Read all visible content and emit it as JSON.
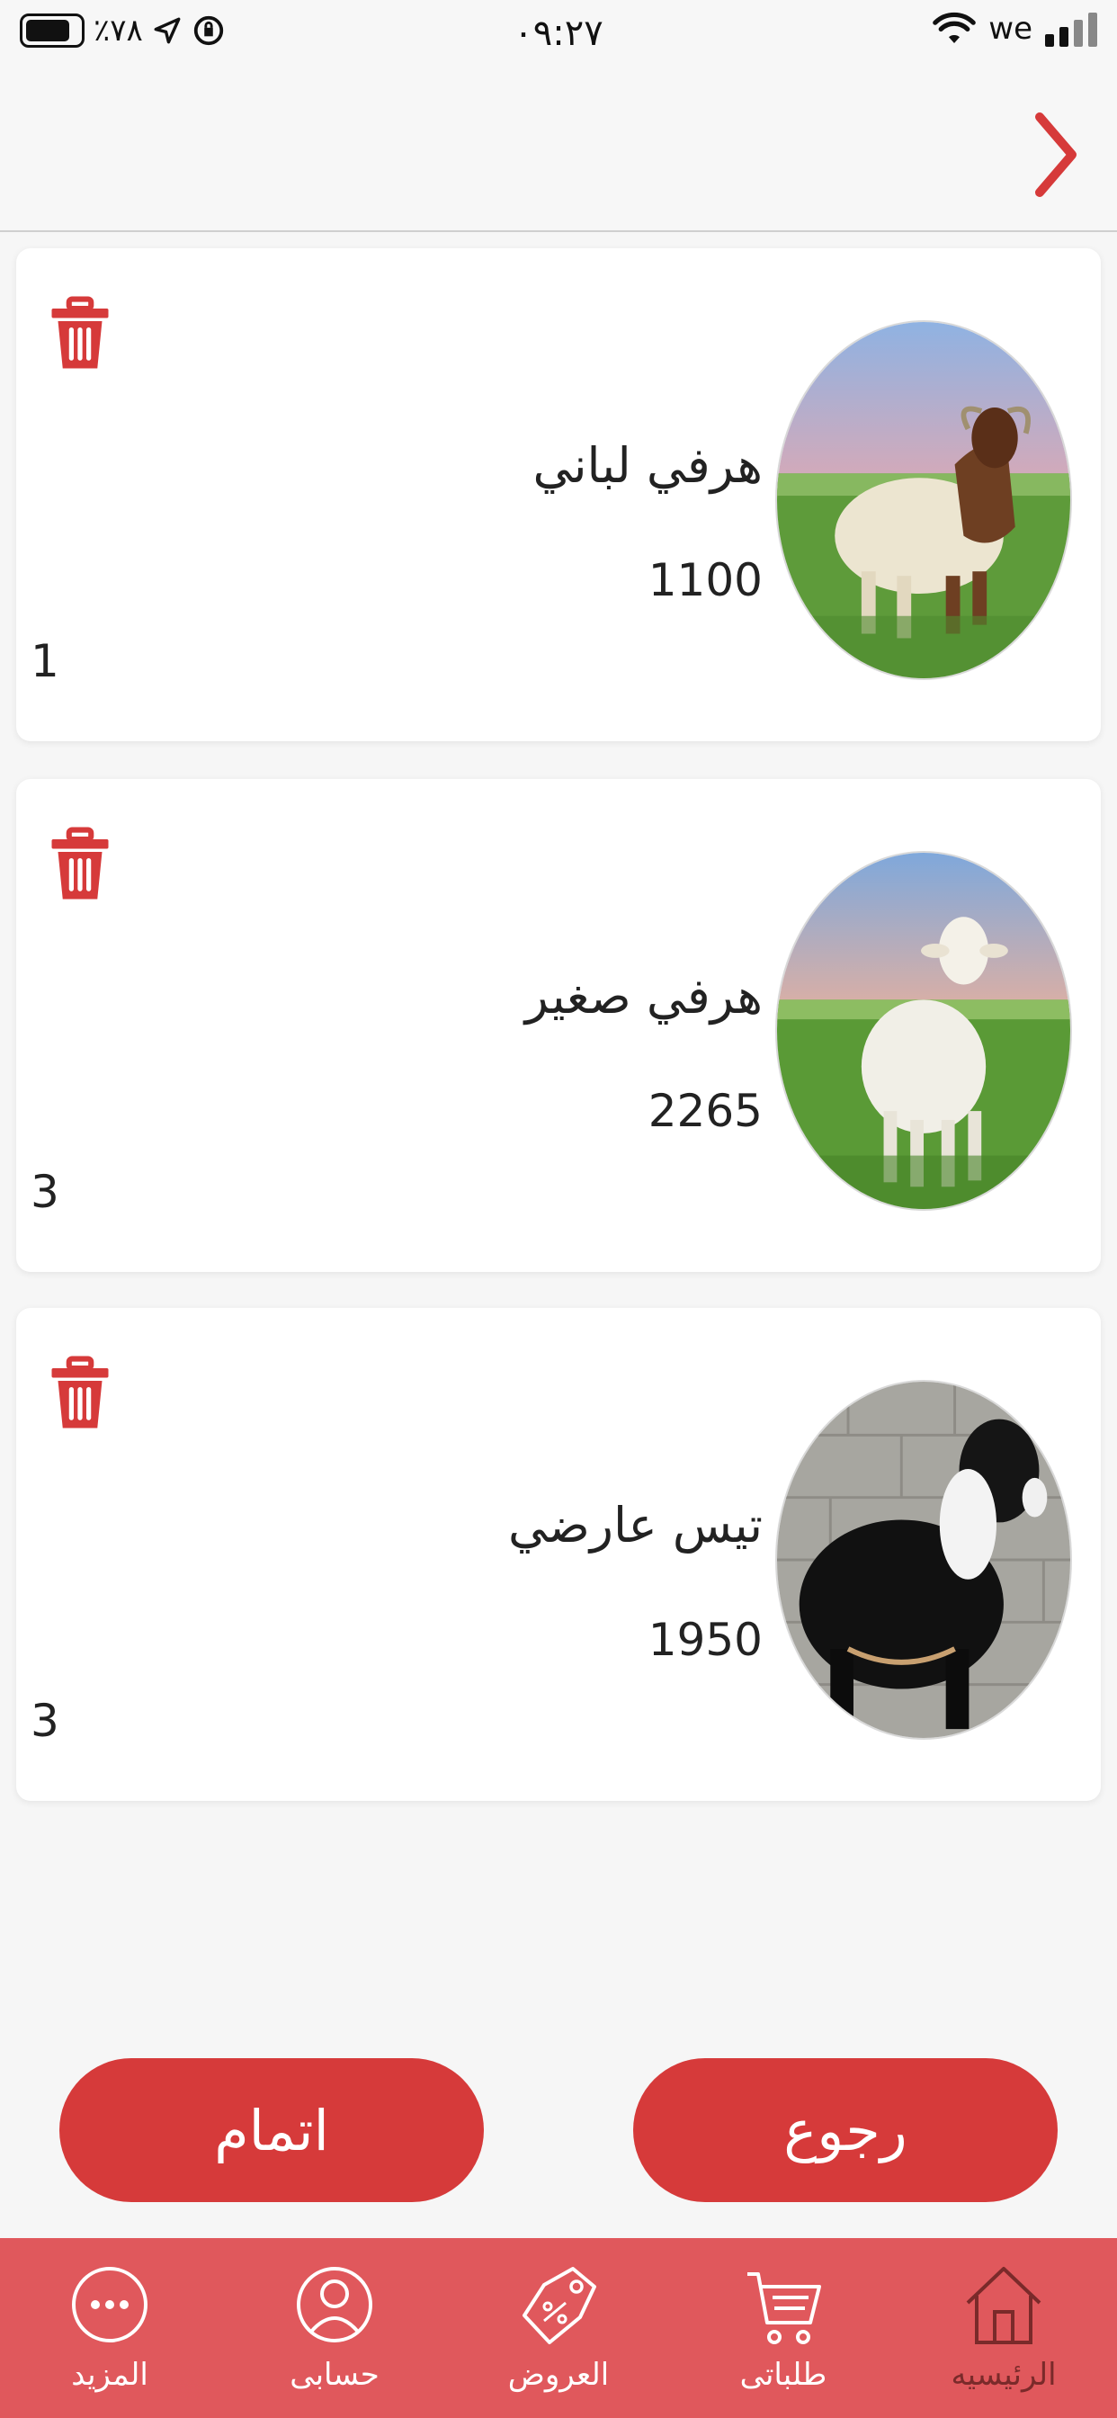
{
  "status_bar": {
    "battery": "٪٧٨",
    "time": "٠٩:٢٧",
    "carrier": "we"
  },
  "cart": {
    "items": [
      {
        "name": "هرفي لباني",
        "price": "1100",
        "quantity": "1",
        "image_icon": "sheep-photo"
      },
      {
        "name": "هرفي صغير",
        "price": "2265",
        "quantity": "3",
        "image_icon": "lamb-photo"
      },
      {
        "name": "تيس عارضي",
        "price": "1950",
        "quantity": "3",
        "image_icon": "goat-photo"
      }
    ]
  },
  "actions": {
    "finish_label": "اتمام",
    "back_label": "رجوع"
  },
  "bottom_nav": {
    "items": [
      {
        "label": "المزيد",
        "icon": "more-icon"
      },
      {
        "label": "حسابى",
        "icon": "user-icon"
      },
      {
        "label": "العروض",
        "icon": "offers-tag-icon"
      },
      {
        "label": "طلباتى",
        "icon": "cart-icon"
      },
      {
        "label": "الرئيسيه",
        "icon": "home-icon",
        "active": true
      }
    ]
  },
  "colors": {
    "accent": "#d63a3a",
    "nav_background": "#e0585c",
    "nav_active_text": "#7a2a2a"
  }
}
